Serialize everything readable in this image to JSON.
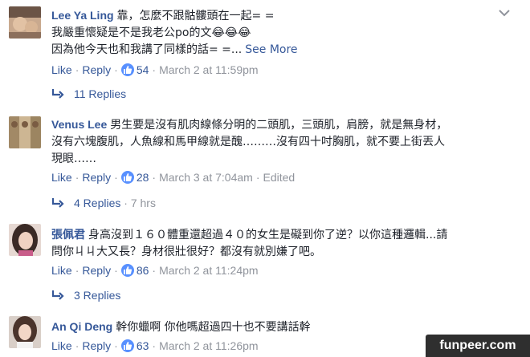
{
  "comments": [
    {
      "author": "Lee Ya Ling",
      "lines": [
        "靠，怎麼不跟骷髏頭在一起= =",
        "我嚴重懷疑是不是我老公po的文😂😂😂",
        "因為他今天也和我講了同樣的話= =..."
      ],
      "see_more": "See More",
      "like_label": "Like",
      "reply_label": "Reply",
      "like_count": "54",
      "timestamp": "March 2 at 11:59pm",
      "edited": "",
      "replies": "11 Replies",
      "replies_age": ""
    },
    {
      "author": "Venus Lee",
      "lines": [
        "男生要是沒有肌肉線條分明的二頭肌，三頭肌，肩膀，就是無身材，",
        "沒有六塊腹肌，人魚線和馬甲線就是醜………沒有四十吋胸肌，就不要上街丟人",
        "現眼……"
      ],
      "see_more": "",
      "like_label": "Like",
      "reply_label": "Reply",
      "like_count": "28",
      "timestamp": "March 3 at 7:04am",
      "edited": "Edited",
      "replies": "4 Replies",
      "replies_age": "7 hrs"
    },
    {
      "author": "張佩君",
      "lines": [
        "身高沒到１６０體重還超過４０的女生是礙到你了逆？以你這種邏輯...請",
        "問你ㄐㄐ大又長？身材很壯很好？都沒有就別嫌了吧。"
      ],
      "see_more": "",
      "like_label": "Like",
      "reply_label": "Reply",
      "like_count": "86",
      "timestamp": "March 2 at 11:24pm",
      "edited": "",
      "replies": "3 Replies",
      "replies_age": ""
    },
    {
      "author": "An Qi Deng",
      "lines": [
        "幹你蠟啊 你他嗎超過四十也不要講話幹"
      ],
      "see_more": "",
      "like_label": "Like",
      "reply_label": "Reply",
      "like_count": "63",
      "timestamp": "March 2 at 11:26pm",
      "edited": "",
      "replies": "",
      "replies_age": ""
    }
  ],
  "watermark": "funpeer.com",
  "colors": {
    "link": "#365899",
    "meta": "#90949c",
    "text": "#1d2129",
    "like_badge": "#5890ff"
  },
  "icons": {
    "options": "chevron-down-icon",
    "reply_arrow": "reply-arrow-icon",
    "like": "thumbs-up-icon"
  }
}
